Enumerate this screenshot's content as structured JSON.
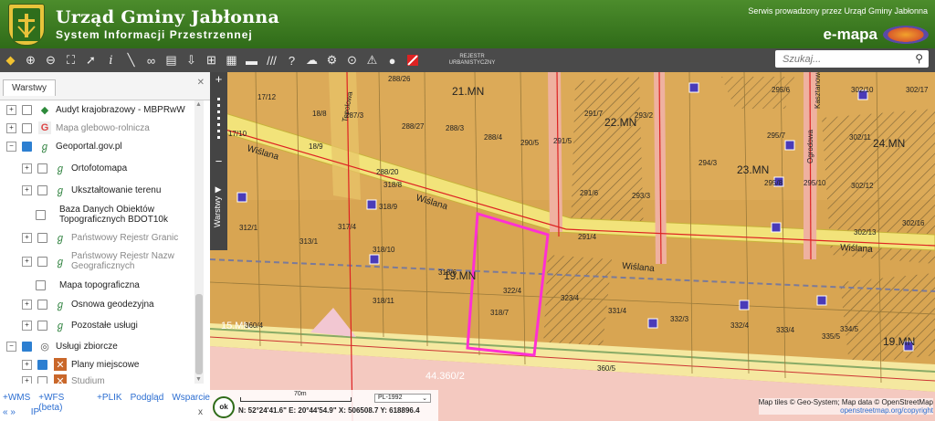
{
  "header": {
    "title": "Urząd Gminy Jabłonna",
    "subtitle": "System Informacji Przestrzennej",
    "service_note": "Serwis prowadzony przez Urząd Gminy Jabłonna",
    "brand": "e-mapa"
  },
  "toolbar": {
    "buttons": [
      "layers-icon",
      "zoom-in-icon",
      "zoom-out-icon",
      "zoom-extent-icon",
      "pointer-icon",
      "info-icon",
      "measure-icon",
      "link-icon",
      "print-icon",
      "download-icon",
      "grid-icon",
      "layout-icon",
      "comment-icon",
      "hatch-icon",
      "help-icon",
      "cloud-icon",
      "settings-icon",
      "search-map-icon",
      "warning-icon",
      "marker-icon",
      "no-entry-icon"
    ],
    "rejestr_line1": "REJESTR",
    "rejestr_line2": "URBANISTYCZNY",
    "search_placeholder": "Szukaj..."
  },
  "panel": {
    "tab": "Warstwy",
    "layers": [
      {
        "label": "Audyt krajobrazowy - MBPRwW",
        "checked": false,
        "grey": false
      },
      {
        "label": "Mapa glebowo-rolnicza",
        "checked": false,
        "grey": true
      },
      {
        "label": "Geoportal.gov.pl",
        "checked": true,
        "grey": false
      },
      {
        "label": "Ortofotomapa",
        "checked": false,
        "grey": false
      },
      {
        "label": "Ukształtowanie terenu",
        "checked": false,
        "grey": false
      },
      {
        "label": "Baza Danych Obiektów Topograficznych BDOT10k",
        "checked": false,
        "grey": false
      },
      {
        "label": "Państwowy Rejestr Granic",
        "checked": false,
        "grey": true
      },
      {
        "label": "Państwowy Rejestr Nazw Geograficznych",
        "checked": false,
        "grey": true
      },
      {
        "label": "Mapa topograficzna",
        "checked": false,
        "grey": false
      },
      {
        "label": "Osnowa geodezyjna",
        "checked": false,
        "grey": false
      },
      {
        "label": "Pozostałe usługi",
        "checked": false,
        "grey": false
      },
      {
        "label": "Usługi zbiorcze",
        "checked": true,
        "grey": false
      },
      {
        "label": "Plany miejscowe",
        "checked": true,
        "grey": false
      },
      {
        "label": "Studium",
        "checked": false,
        "grey": true
      }
    ],
    "links": [
      "+WMS",
      "+WFS (beta)",
      "+PLIK",
      "Podgląd",
      "Wsparcie"
    ],
    "bottom_ip": "IP",
    "bottom_nav": "« »",
    "bottom_x": "x"
  },
  "map": {
    "side_tab": "Warstwy",
    "scale_label": "70m",
    "crs": "PL-1992",
    "ok": "ok",
    "coords": "N: 52°24'41.6\"  E: 20°44'54.9\"  X: 506508.7  Y: 618896.4",
    "attribution_line1": "Map tiles © Geo-System; Map data © OpenStreetMap",
    "attribution_line2": "openstreetmap.org/copyright",
    "labels": {
      "p17_12": "17/12",
      "p18_8": "18/8",
      "p287_3": "287/3",
      "p288_26": "288/26",
      "p288_27": "288/27",
      "p288_3": "288/3",
      "p288_4": "288/4",
      "p290_5": "290/5",
      "p17_10": "17/10",
      "p18_9": "18/9",
      "p21mn": "21.MN",
      "p291_7": "291/7",
      "p22mn": "22.MN",
      "p293_2": "293/2",
      "p291_5": "291/5",
      "p294_3": "294/3",
      "p23mn": "23.MN",
      "p295_6": "295/6",
      "p295_7": "295/7",
      "p295_8": "295/8",
      "p295_10": "295/10",
      "p302_10": "302/10",
      "p302_17": "302/17",
      "p302_11": "302/11",
      "p24mn": "24.MN",
      "p302_12": "302/12",
      "p302_16": "302/16",
      "p302_13": "302/13",
      "p288_20": "288/20",
      "p318_8": "318/8",
      "p318_9": "318/9",
      "p312_1": "312/1",
      "p313_1": "313/1",
      "p317_4": "317/4",
      "p318_10": "318/10",
      "p291_6": "291/6",
      "p293_3": "293/3",
      "p291_4": "291/4",
      "p318_6": "318/6",
      "p19mn": "19.MN",
      "p322_4": "322/4",
      "p323_4": "323/4",
      "p318_11": "318/11",
      "p318_7": "318/7",
      "p331_4": "331/4",
      "p332_3": "332/3",
      "p332_4": "332/4",
      "p333_4": "333/4",
      "p334_5": "334/5",
      "p335_5": "335/5",
      "p15mn": "15.MN",
      "p360_5": "360/5",
      "p360_4": "360/4",
      "p44": "44.360/2",
      "p19mn_b": "19.MN",
      "street1": "Wiślana",
      "street2": "Wiślana",
      "street3": "Wiślana",
      "street4": "Topolowa",
      "street5": "Ogrodowa",
      "street6": "Kasztanowa"
    }
  }
}
